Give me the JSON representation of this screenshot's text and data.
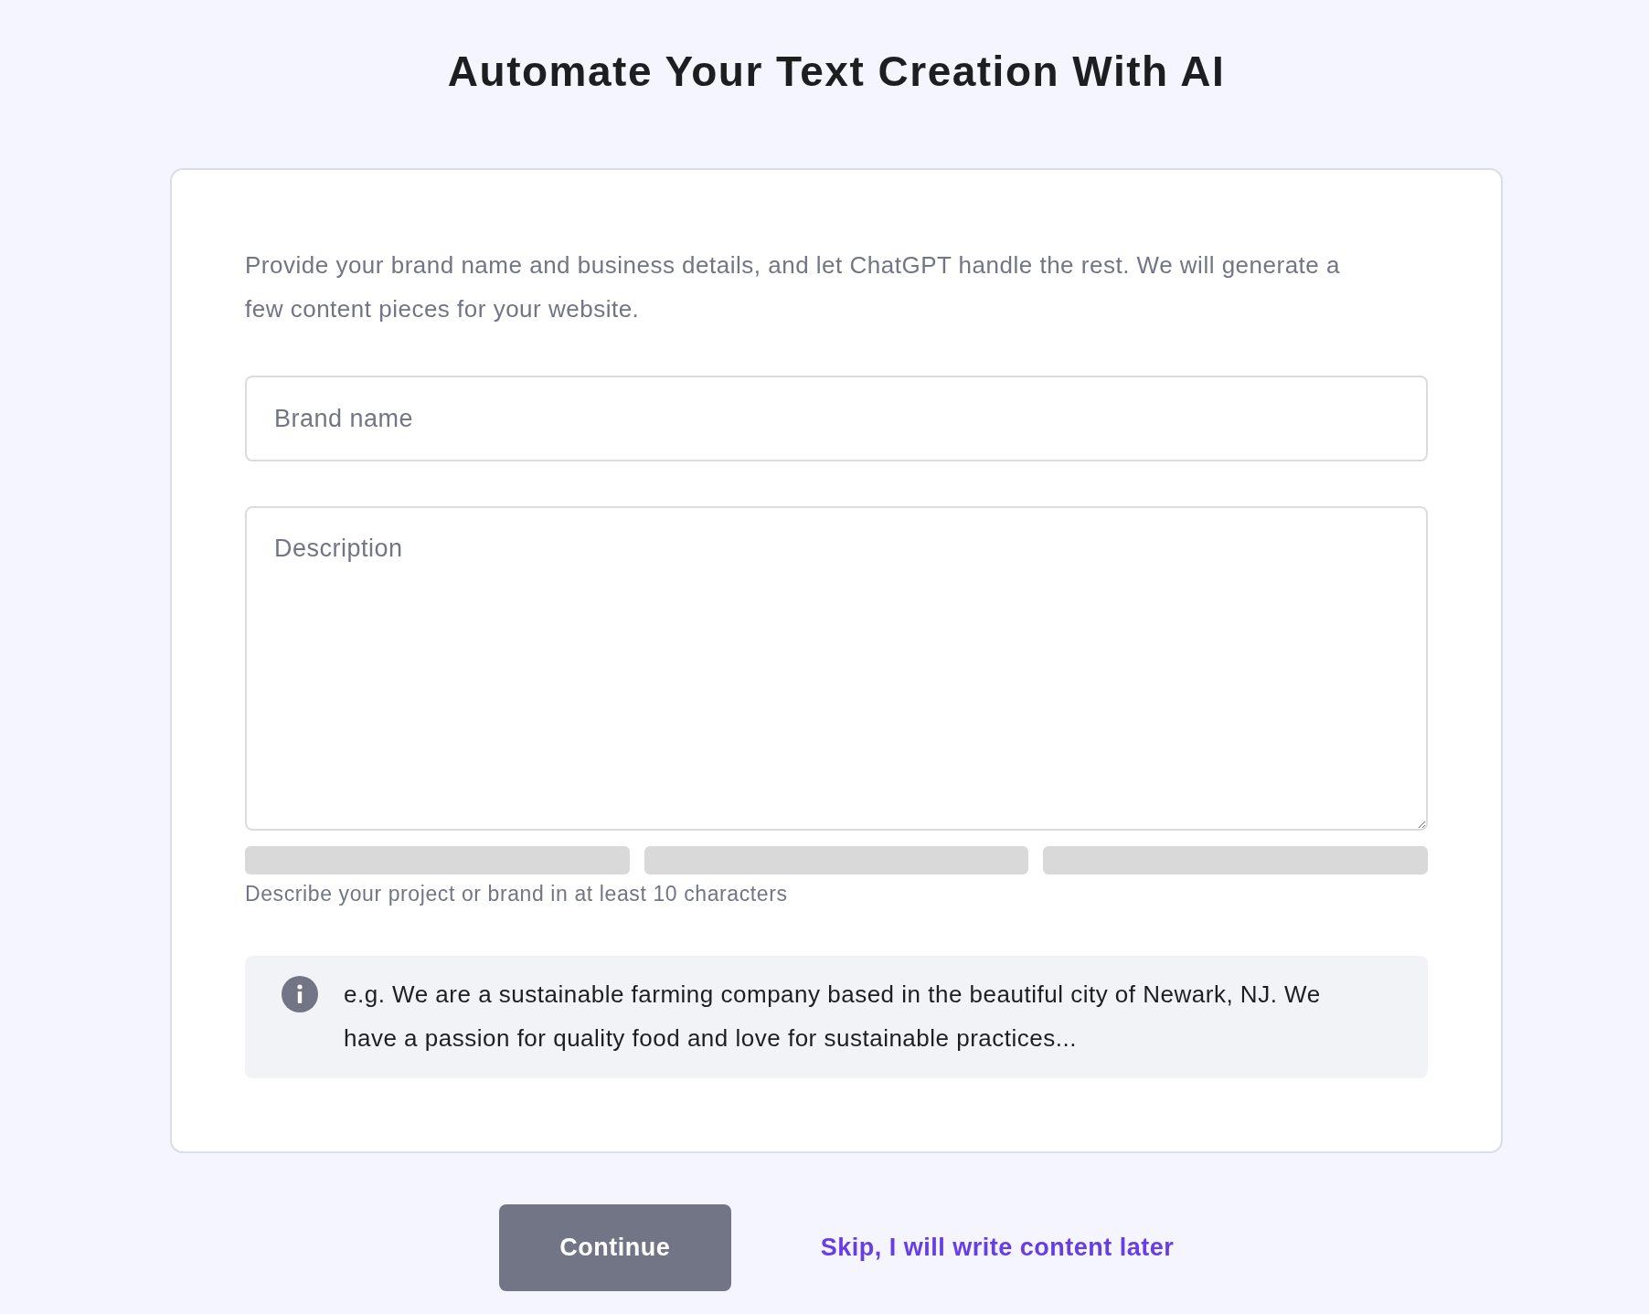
{
  "title": "Automate Your Text Creation With AI",
  "card": {
    "intro": "Provide your brand name and business details, and let ChatGPT handle the rest. We will generate a few content pieces for your website.",
    "brand_name": {
      "placeholder": "Brand name"
    },
    "description": {
      "placeholder": "Description"
    },
    "strength_meter": {
      "segments": [
        {
          "filled": false
        },
        {
          "filled": false
        },
        {
          "filled": false
        }
      ]
    },
    "hint": "Describe your project or brand in at least 10 characters",
    "example": {
      "text": "e.g. We are a sustainable farming company based in the beautiful city of Newark, NJ. We have a passion for quality food and love for sustainable practices..."
    }
  },
  "actions": {
    "continue_button": {
      "label": "Continue",
      "disabled": true
    },
    "skip_link": {
      "label": "Skip, I will write content later"
    }
  }
}
